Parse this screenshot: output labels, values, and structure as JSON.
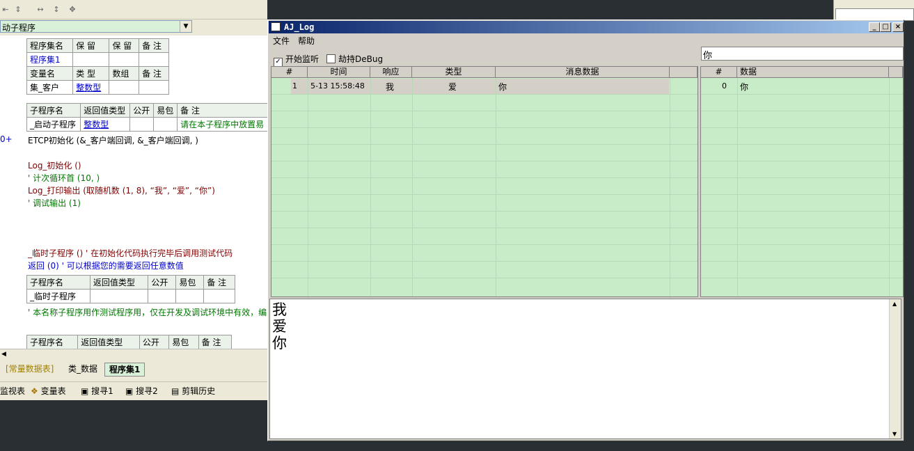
{
  "ide": {
    "combo_value": "动子程序",
    "header_table": {
      "row1": [
        "程序集名",
        "保 留",
        "保 留",
        "备 注"
      ],
      "row2": [
        "程序集1",
        "",
        "",
        ""
      ],
      "row3": [
        "变量名",
        "类 型",
        "数组",
        "备 注"
      ],
      "row4": [
        "集_客户",
        "整数型",
        "",
        ""
      ]
    },
    "sub_table1": {
      "headers": [
        "子程序名",
        "返回值类型",
        "公开",
        "易包",
        "备 注"
      ],
      "row": [
        "_启动子程序",
        "整数型",
        "",
        "",
        "请在本子程序中放置易"
      ]
    },
    "code_lines": [
      "ETCP初始化 (&_客户端回调, &_客户端回调, )",
      "Log_初始化 ()",
      "' 计次循环首 (10, )",
      "Log_打印输出 (取随机数 (1, 8), “我”, “爱”, “你”)",
      "' 调试输出 (1)",
      "_临时子程序 ()  ' 在初始化代码执行完毕后调用测试代码",
      "返回 (0)  ' 可以根据您的需要返回任意数值"
    ],
    "gutter_mark": "0+",
    "sub_table2": {
      "headers": [
        "子程序名",
        "返回值类型",
        "公开",
        "易包",
        "备 注"
      ],
      "row": [
        "_临时子程序",
        "",
        "",
        "",
        ""
      ]
    },
    "comment_line": "' 本名称子程序用作测试程序用，仅在开发及调试环境中有效，编",
    "sub_table3": {
      "headers": [
        "子程序名",
        "返回值类型",
        "公开",
        "易包",
        "备 注"
      ]
    },
    "tabs": [
      "[常量数据表]",
      "类_数据",
      "程序集1"
    ],
    "bottom_tabs": [
      "监视表",
      "变量表",
      "搜寻1",
      "搜寻2",
      "剪辑历史"
    ]
  },
  "log_window": {
    "title": "AJ_Log",
    "menu": [
      "文件",
      "帮助"
    ],
    "checkbox_listen": {
      "label": "开始监听",
      "checked": true
    },
    "checkbox_debug": {
      "label": "劫持DeBug",
      "checked": false
    },
    "search_value": "你",
    "list_columns": [
      "#",
      "时间",
      "响应",
      "类型",
      "消息数据"
    ],
    "list_rows": [
      {
        "num": "1",
        "time": "5-13 15:58:48",
        "resp": "我",
        "type": "爱",
        "msg": "你"
      }
    ],
    "data_columns": [
      "#",
      "数据"
    ],
    "data_rows": [
      {
        "num": "0",
        "data": "你"
      }
    ],
    "text_output": "我\n爱\n你",
    "colors": {
      "list_bg": "#c8ebc8",
      "title_start": "#0a246a",
      "title_end": "#a6caf0"
    }
  }
}
